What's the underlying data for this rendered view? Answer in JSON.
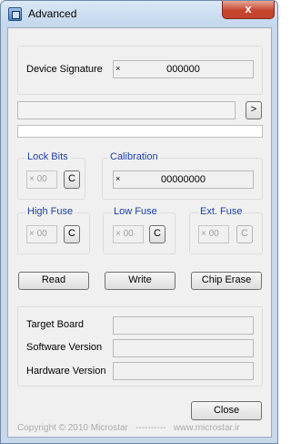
{
  "window": {
    "title": "Advanced",
    "close_glyph": "x"
  },
  "device_signature": {
    "label": "Device Signature",
    "prefix": "×",
    "value": "000000"
  },
  "message": {
    "text": "",
    "go_label": ">"
  },
  "progress": {
    "percent": 0
  },
  "lock_bits": {
    "legend": "Lock Bits",
    "value": "× 00",
    "button": "C"
  },
  "calibration": {
    "legend": "Calibration",
    "prefix": "×",
    "value": "00000000"
  },
  "high_fuse": {
    "legend": "High Fuse",
    "value": "× 00",
    "button": "C"
  },
  "low_fuse": {
    "legend": "Low Fuse",
    "value": "× 00",
    "button": "C"
  },
  "ext_fuse": {
    "legend": "Ext. Fuse",
    "value": "× 00",
    "button": "C"
  },
  "actions": {
    "read": "Read",
    "write": "Write",
    "chip_erase": "Chip Erase"
  },
  "info": {
    "target_board": "Target Board",
    "software_version": "Software Version",
    "hardware_version": "Hardware Version"
  },
  "close_button": "Close",
  "footer": "Copyright © 2010 Microstar   ----------   www.microstar.ir"
}
